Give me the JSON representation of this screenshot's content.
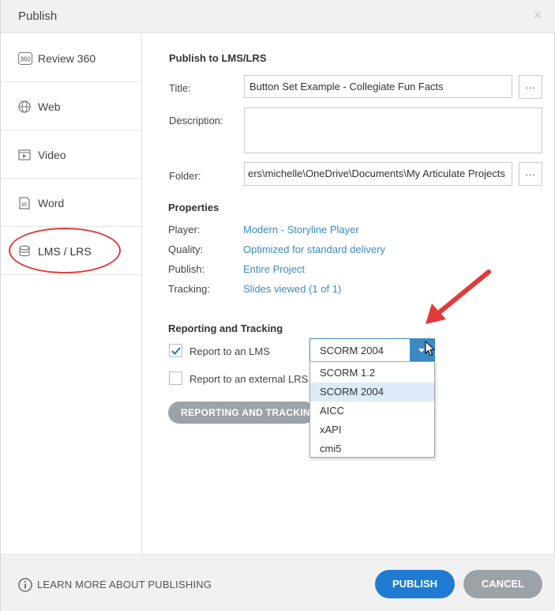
{
  "window": {
    "title": "Publish"
  },
  "sidebar": {
    "items": [
      {
        "label": "Review 360",
        "icon": "review-360-icon",
        "badge": "360"
      },
      {
        "label": "Web",
        "icon": "globe-icon"
      },
      {
        "label": "Video",
        "icon": "film-icon"
      },
      {
        "label": "Word",
        "icon": "word-document-icon"
      },
      {
        "label": "LMS / LRS",
        "icon": "database-icon",
        "active": true
      }
    ]
  },
  "publish": {
    "heading": "Publish to LMS/LRS",
    "title_label": "Title:",
    "title_value": "Button Set Example - Collegiate Fun Facts",
    "description_label": "Description:",
    "description_value": "",
    "folder_label": "Folder:",
    "folder_value": "ers\\michelle\\OneDrive\\Documents\\My Articulate Projects",
    "browse_label": "..."
  },
  "properties": {
    "heading": "Properties",
    "rows": [
      {
        "label": "Player:",
        "value": "Modern - Storyline Player"
      },
      {
        "label": "Quality:",
        "value": "Optimized for standard delivery"
      },
      {
        "label": "Publish:",
        "value": "Entire Project"
      },
      {
        "label": "Tracking:",
        "value": "Slides viewed (1 of 1)"
      }
    ]
  },
  "reporting": {
    "heading": "Reporting and Tracking",
    "report_lms_label": "Report to an LMS",
    "report_lms_checked": true,
    "report_lrs_label": "Report to an external LRS",
    "report_lrs_checked": false,
    "lms_select_value": "SCORM 2004",
    "lms_options": [
      "SCORM 1.2",
      "SCORM 2004",
      "AICC",
      "xAPI",
      "cmi5"
    ],
    "lms_selected_index": 1,
    "button_label": "REPORTING AND TRACKING..."
  },
  "footer": {
    "learn_more": "LEARN MORE ABOUT PUBLISHING",
    "publish_label": "PUBLISH",
    "cancel_label": "CANCEL"
  },
  "colors": {
    "accent": "#1f7bd1",
    "link": "#3b8ac4",
    "annotation": "#e03a3a",
    "button_gray": "#9ba3a9"
  }
}
